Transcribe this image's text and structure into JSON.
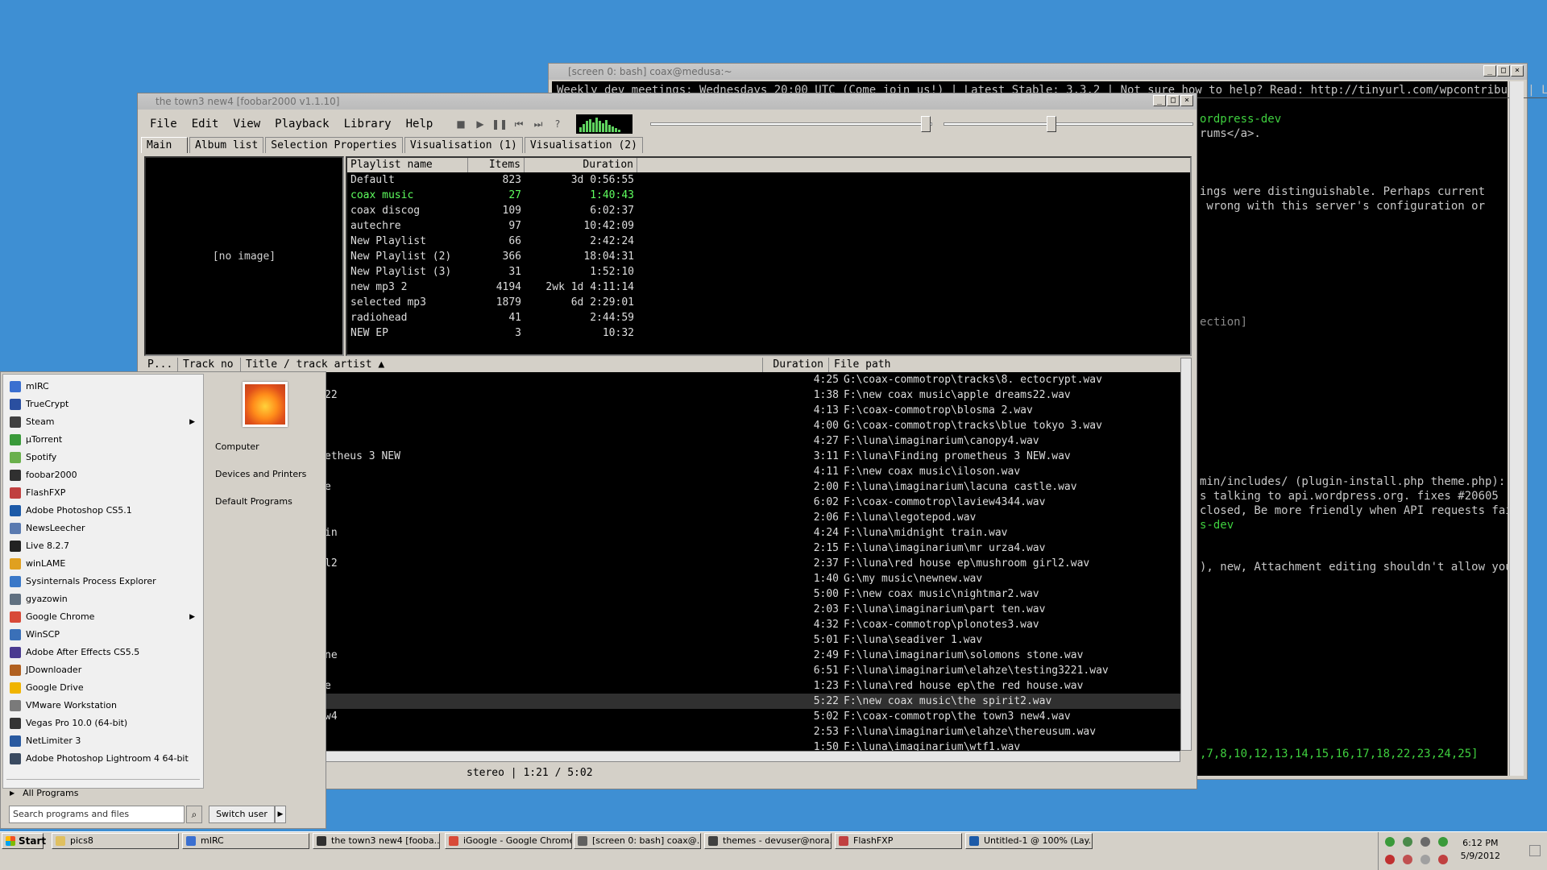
{
  "bash": {
    "title": "[screen 0: bash] coax@medusa:~",
    "lines": [
      "Weekly dev meetings: Wednesdays 20:00 UTC (Come join us!) | Latest Stable: 3.3.2 | Not sure how to help? Read: http://tinyurl.com/wpcontribute | Log",
      "ordpress-dev",
      "rums</a>.",
      "ings were distinguishable. Perhaps current",
      " wrong with this server's configuration or",
      "ection]",
      "min/includes/ (plugin-install.php theme.php):",
      "s talking to api.wordpress.org. fixes #20605",
      "closed, Be more friendly when API requests fail",
      "s-dev",
      "), new, Attachment editing shouldn't allow you",
      ",7,8,10,12,13,14,15,16,17,18,22,23,24,25]"
    ]
  },
  "foobar": {
    "title": "the town3 new4  [foobar2000 v1.1.10]",
    "menu": [
      "File",
      "Edit",
      "View",
      "Playback",
      "Library",
      "Help"
    ],
    "tabs": [
      "Main",
      "Album list",
      "Selection Properties",
      "Visualisation (1)",
      "Visualisation (2)"
    ],
    "no_image": "[no image]",
    "playlist_headers": [
      "Playlist name",
      "Items",
      "Duration"
    ],
    "playlists": [
      {
        "name": "Default",
        "items": "823",
        "duration": "3d 0:56:55",
        "active": false
      },
      {
        "name": "coax music",
        "items": "27",
        "duration": "1:40:43",
        "active": true
      },
      {
        "name": "coax discog",
        "items": "109",
        "duration": "6:02:37",
        "active": false
      },
      {
        "name": "autechre",
        "items": "97",
        "duration": "10:42:09",
        "active": false
      },
      {
        "name": "New Playlist",
        "items": "66",
        "duration": "2:42:24",
        "active": false
      },
      {
        "name": "New Playlist (2)",
        "items": "366",
        "duration": "18:04:31",
        "active": false
      },
      {
        "name": "New Playlist (3)",
        "items": "31",
        "duration": "1:52:10",
        "active": false
      },
      {
        "name": "new mp3 2",
        "items": "4194",
        "duration": "2wk 1d 4:11:14",
        "active": false
      },
      {
        "name": "selected mp3",
        "items": "1879",
        "duration": "6d 2:29:01",
        "active": false
      },
      {
        "name": "radiohead",
        "items": "41",
        "duration": "2:44:59",
        "active": false
      },
      {
        "name": "NEW EP",
        "items": "3",
        "duration": "10:32",
        "active": false
      }
    ],
    "track_headers": [
      "P...",
      "Track no",
      "Title / track artist",
      "Duration",
      "File path"
    ],
    "tracks": [
      {
        "title": "",
        "duration": "4:25",
        "path": "G:\\coax-commotrop\\tracks\\8. ectocrypt.wav",
        "sel": false
      },
      {
        "title": "22",
        "duration": "1:38",
        "path": "F:\\new coax music\\apple dreams22.wav",
        "sel": false
      },
      {
        "title": "",
        "duration": "4:13",
        "path": "F:\\coax-commotrop\\blosma 2.wav",
        "sel": false
      },
      {
        "title": "",
        "duration": "4:00",
        "path": "G:\\coax-commotrop\\tracks\\blue tokyo 3.wav",
        "sel": false
      },
      {
        "title": "",
        "duration": "4:27",
        "path": "F:\\luna\\imaginarium\\canopy4.wav",
        "sel": false
      },
      {
        "title": "etheus 3 NEW",
        "duration": "3:11",
        "path": "F:\\luna\\Finding prometheus 3 NEW.wav",
        "sel": false
      },
      {
        "title": "",
        "duration": "4:11",
        "path": "F:\\new coax music\\iloson.wav",
        "sel": false
      },
      {
        "title": "e",
        "duration": "2:00",
        "path": "F:\\luna\\imaginarium\\lacuna castle.wav",
        "sel": false
      },
      {
        "title": "",
        "duration": "6:02",
        "path": "F:\\coax-commotrop\\laview4344.wav",
        "sel": false
      },
      {
        "title": "",
        "duration": "2:06",
        "path": "F:\\luna\\legotepod.wav",
        "sel": false
      },
      {
        "title": "in",
        "duration": "4:24",
        "path": "F:\\luna\\midnight train.wav",
        "sel": false
      },
      {
        "title": "",
        "duration": "2:15",
        "path": "F:\\luna\\imaginarium\\mr urza4.wav",
        "sel": false
      },
      {
        "title": "l2",
        "duration": "2:37",
        "path": "F:\\luna\\red house ep\\mushroom girl2.wav",
        "sel": false
      },
      {
        "title": "",
        "duration": "1:40",
        "path": "G:\\my music\\newnew.wav",
        "sel": false
      },
      {
        "title": "",
        "duration": "5:00",
        "path": "F:\\new coax music\\nightmar2.wav",
        "sel": false
      },
      {
        "title": "",
        "duration": "2:03",
        "path": "F:\\luna\\imaginarium\\part ten.wav",
        "sel": false
      },
      {
        "title": "",
        "duration": "4:32",
        "path": "F:\\coax-commotrop\\plonotes3.wav",
        "sel": false
      },
      {
        "title": "",
        "duration": "5:01",
        "path": "F:\\luna\\seadiver 1.wav",
        "sel": false
      },
      {
        "title": "ne",
        "duration": "2:49",
        "path": "F:\\luna\\imaginarium\\solomons stone.wav",
        "sel": false
      },
      {
        "title": "",
        "duration": "6:51",
        "path": "F:\\luna\\imaginarium\\elahze\\testing3221.wav",
        "sel": false
      },
      {
        "title": "e",
        "duration": "1:23",
        "path": "F:\\luna\\red house ep\\the red house.wav",
        "sel": false
      },
      {
        "title": "",
        "duration": "5:22",
        "path": "F:\\new coax music\\the spirit2.wav",
        "sel": true
      },
      {
        "title": "w4",
        "duration": "5:02",
        "path": "F:\\coax-commotrop\\the town3 new4.wav",
        "sel": false
      },
      {
        "title": "",
        "duration": "2:53",
        "path": "F:\\luna\\imaginarium\\elahze\\thereusum.wav",
        "sel": false
      },
      {
        "title": "",
        "duration": "1:50",
        "path": "F:\\luna\\imaginarium\\wtf1.wav",
        "sel": false
      }
    ],
    "status": "stereo | 1:21 / 5:02"
  },
  "startmenu": {
    "programs": [
      {
        "label": "mIRC",
        "color": "#3a6fd0",
        "submenu": false
      },
      {
        "label": "TrueCrypt",
        "color": "#2a4fa0",
        "submenu": false
      },
      {
        "label": "Steam",
        "color": "#404040",
        "submenu": true
      },
      {
        "label": "µTorrent",
        "color": "#3a9a3a",
        "submenu": false
      },
      {
        "label": "Spotify",
        "color": "#6ab04c",
        "submenu": false
      },
      {
        "label": "foobar2000",
        "color": "#303030",
        "submenu": false
      },
      {
        "label": "FlashFXP",
        "color": "#c04040",
        "submenu": false
      },
      {
        "label": "Adobe Photoshop CS5.1",
        "color": "#1c5aa8",
        "submenu": false
      },
      {
        "label": "NewsLeecher",
        "color": "#5a7ab0",
        "submenu": false
      },
      {
        "label": "Live 8.2.7",
        "color": "#222222",
        "submenu": false
      },
      {
        "label": "winLAME",
        "color": "#e0a020",
        "submenu": false
      },
      {
        "label": "Sysinternals Process Explorer",
        "color": "#3a78c8",
        "submenu": false
      },
      {
        "label": "gyazowin",
        "color": "#607080",
        "submenu": false
      },
      {
        "label": "Google Chrome",
        "color": "#d84a38",
        "submenu": true
      },
      {
        "label": "WinSCP",
        "color": "#3a70b8",
        "submenu": false
      },
      {
        "label": "Adobe After Effects CS5.5",
        "color": "#4a3a90",
        "submenu": false
      },
      {
        "label": "JDownloader",
        "color": "#b06020",
        "submenu": false
      },
      {
        "label": "Google Drive",
        "color": "#f0b400",
        "submenu": false
      },
      {
        "label": "VMware Workstation",
        "color": "#7a7a7a",
        "submenu": false
      },
      {
        "label": "Vegas Pro 10.0 (64-bit)",
        "color": "#333333",
        "submenu": false
      },
      {
        "label": "NetLimiter 3",
        "color": "#2a5aa0",
        "submenu": false
      },
      {
        "label": "Adobe Photoshop Lightroom 4 64-bit",
        "color": "#3a4a60",
        "submenu": false
      }
    ],
    "all_programs": "All Programs",
    "right_links": [
      "Computer",
      "Devices and Printers",
      "Default Programs"
    ],
    "search_placeholder": "Search programs and files",
    "switch_user": "Switch user"
  },
  "taskbar": {
    "start_label": "Start",
    "tasks": [
      {
        "label": "pics8",
        "color": "#e0c060"
      },
      {
        "label": "mIRC",
        "color": "#3a6fd0"
      },
      {
        "label": "the town3 new4  [fooba...",
        "color": "#303030"
      },
      {
        "label": "iGoogle - Google Chrome",
        "color": "#d84a38"
      },
      {
        "label": "[screen 0: bash] coax@...",
        "color": "#606060"
      },
      {
        "label": "themes - devuser@nora...",
        "color": "#404040"
      },
      {
        "label": "FlashFXP",
        "color": "#c04040"
      },
      {
        "label": "Untitled-1 @ 100% (Lay...",
        "color": "#1c5aa8"
      }
    ],
    "time": "6:12 PM",
    "date": "5/9/2012"
  }
}
